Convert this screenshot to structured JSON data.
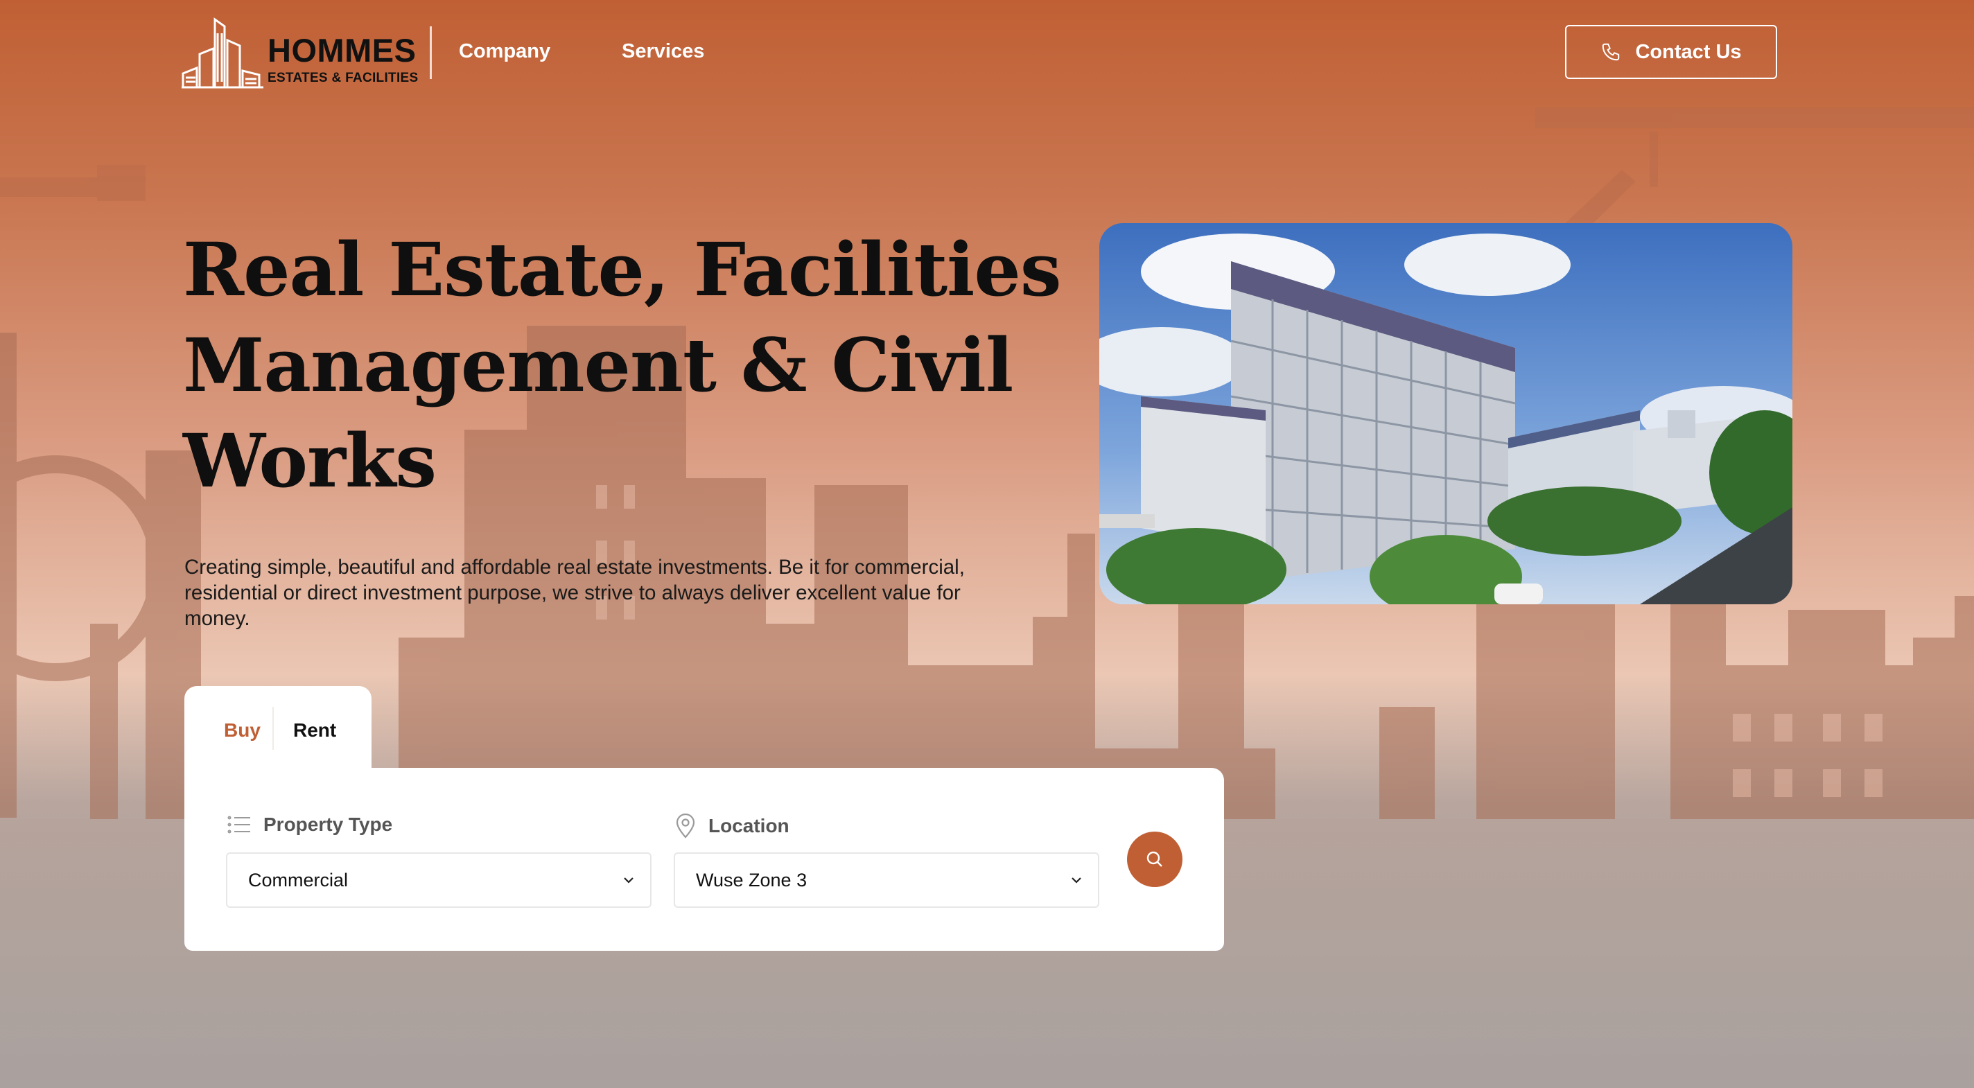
{
  "header": {
    "logo": {
      "name": "HOMMES",
      "tagline": "ESTATES & FACILITIES"
    },
    "nav": [
      {
        "label": "Company"
      },
      {
        "label": "Services"
      }
    ],
    "contact_label": "Contact Us"
  },
  "hero": {
    "title": "Real Estate, Facilities Management & Civil Works",
    "description": "Creating simple, beautiful and affordable real estate investments. Be it for commercial, residential or direct investment purpose, we strive to always deliver excellent value for money."
  },
  "search": {
    "tabs": [
      {
        "label": "Buy",
        "active": true
      },
      {
        "label": "Rent",
        "active": false
      }
    ],
    "property_type": {
      "label": "Property Type",
      "value": "Commercial"
    },
    "location": {
      "label": "Location",
      "value": "Wuse Zone 3"
    }
  },
  "icons": {
    "contact": "phone-icon",
    "property_type": "list-icon",
    "location": "map-pin-icon",
    "search": "search-icon",
    "select": "chevron-down-icon"
  },
  "colors": {
    "brand": "#c05f34",
    "text": "#0f0f0f",
    "white": "#ffffff"
  }
}
